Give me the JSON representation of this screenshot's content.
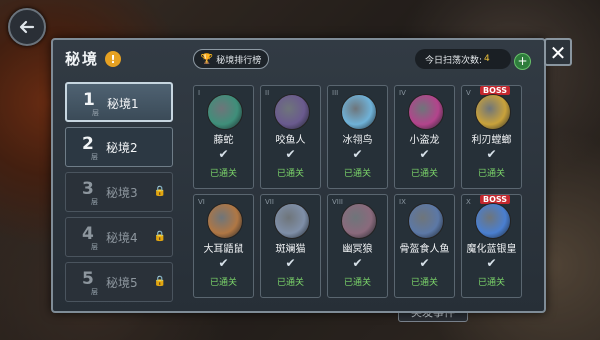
{
  "panel": {
    "title": "秘境",
    "info_icon": "!",
    "rank_button": "秘境排行榜",
    "sweep_label": "今日扫荡次数:",
    "sweep_count": "4",
    "plus": "+",
    "close": "✕"
  },
  "background": {
    "banner_text": "突发事件"
  },
  "floors": [
    {
      "n": "1",
      "ceng": "层",
      "name": "秘境1",
      "state": "active"
    },
    {
      "n": "2",
      "ceng": "层",
      "name": "秘境2",
      "state": "open"
    },
    {
      "n": "3",
      "ceng": "层",
      "name": "秘境3",
      "state": "locked"
    },
    {
      "n": "4",
      "ceng": "层",
      "name": "秘境4",
      "state": "locked"
    },
    {
      "n": "5",
      "ceng": "层",
      "name": "秘境5",
      "state": "locked"
    }
  ],
  "monsters": [
    {
      "roman": "I",
      "name": "藤蛇",
      "status": "已通关",
      "boss": "",
      "color": "#3f8f7a"
    },
    {
      "roman": "II",
      "name": "咬鱼人",
      "status": "已通关",
      "boss": "",
      "color": "#6a5a8e"
    },
    {
      "roman": "III",
      "name": "冰翎鸟",
      "status": "已通关",
      "boss": "",
      "color": "#6fb2d8"
    },
    {
      "roman": "IV",
      "name": "小盗龙",
      "status": "已通关",
      "boss": "",
      "color": "#b3448c"
    },
    {
      "roman": "V",
      "name": "利刃螳螂",
      "status": "已通关",
      "boss": "BOSS",
      "color": "#c9a23b"
    },
    {
      "roman": "VI",
      "name": "大耳鼯鼠",
      "status": "已通关",
      "boss": "",
      "color": "#b07744"
    },
    {
      "roman": "VII",
      "name": "斑斓猫",
      "status": "已通关",
      "boss": "",
      "color": "#7f8fa8"
    },
    {
      "roman": "VIII",
      "name": "幽冥狼",
      "status": "已通关",
      "boss": "",
      "color": "#8a6a7c"
    },
    {
      "roman": "IX",
      "name": "骨盔食人鱼",
      "status": "已通关",
      "boss": "",
      "color": "#5c78a6"
    },
    {
      "roman": "X",
      "name": "魔化蓝银皇",
      "status": "已通关",
      "boss": "BOSS",
      "color": "#4a7fd0"
    }
  ]
}
